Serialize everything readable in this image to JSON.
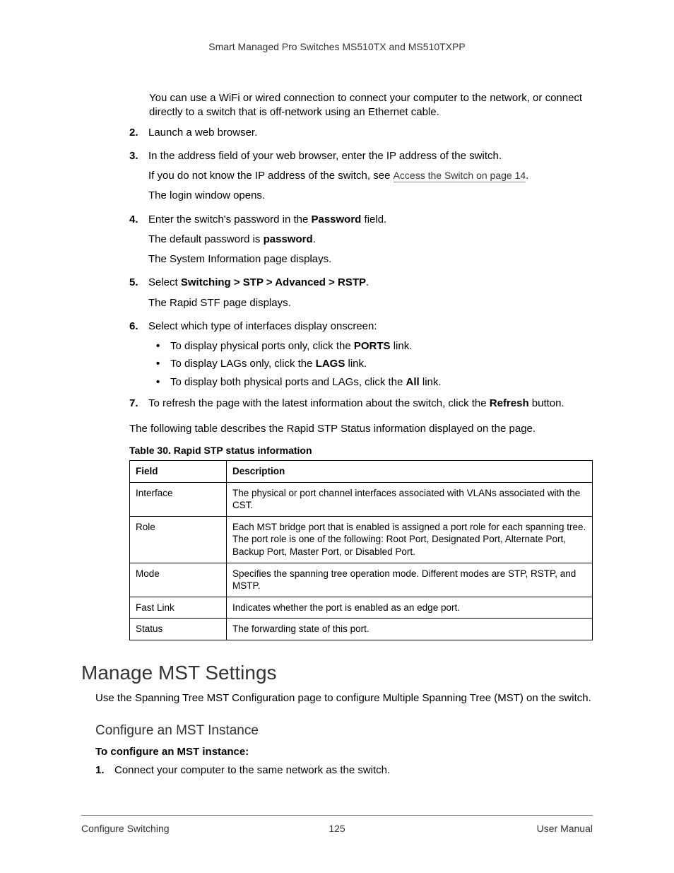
{
  "header": "Smart Managed Pro Switches MS510TX and MS510TXPP",
  "intro_indent": "You can use a WiFi or wired connection to connect your computer to the network, or connect directly to a switch that is off-network using an Ethernet cable.",
  "steps": {
    "s2": {
      "num": "2.",
      "text": "Launch a web browser."
    },
    "s3": {
      "num": "3.",
      "text": "In the address field of your web browser, enter the IP address of the switch.",
      "p1a": "If you do not know the IP address of the switch, see ",
      "link": "Access the Switch on page 14",
      "p1b": ".",
      "p2": "The login window opens."
    },
    "s4": {
      "num": "4.",
      "tpre": "Enter the switch's password in the ",
      "bold": "Password",
      "tpost": " field.",
      "p1a": "The default password is ",
      "p1b": "password",
      "p1c": ".",
      "p2": "The System Information page displays."
    },
    "s5": {
      "num": "5.",
      "tpre": "Select ",
      "bold": "Switching > STP > Advanced > RSTP",
      "tpost": ".",
      "p1": "The Rapid STF page displays."
    },
    "s6": {
      "num": "6.",
      "text": "Select which type of interfaces display onscreen:",
      "bullets": [
        {
          "pre": "To display physical ports only, click the ",
          "bold": "PORTS",
          "post": " link."
        },
        {
          "pre": "To display LAGs only, click the ",
          "bold": "LAGS",
          "post": " link."
        },
        {
          "pre": "To display both physical ports and LAGs, click the ",
          "bold": "All",
          "post": " link."
        }
      ]
    },
    "s7": {
      "num": "7.",
      "pre": "To refresh the page with the latest information about the switch, click the ",
      "bold": "Refresh",
      "post": " button."
    }
  },
  "table_lead": "The following table describes the Rapid STP Status information displayed on the page.",
  "table_caption": "Table 30.  Rapid STP status information",
  "table": {
    "head": {
      "c1": "Field",
      "c2": "Description"
    },
    "rows": [
      {
        "c1": "Interface",
        "c2": "The physical or port channel interfaces associated with VLANs associated with the CST."
      },
      {
        "c1": "Role",
        "c2": "Each MST bridge port that is enabled is assigned a port role for each spanning tree. The port role is one of the following: Root Port, Designated Port, Alternate Port, Backup Port, Master Port, or Disabled Port."
      },
      {
        "c1": "Mode",
        "c2": "Specifies the spanning tree operation mode. Different modes are STP, RSTP, and MSTP."
      },
      {
        "c1": "Fast Link",
        "c2": "Indicates whether the port is enabled as an edge port."
      },
      {
        "c1": "Status",
        "c2": "The forwarding state of this port."
      }
    ]
  },
  "section_title": "Manage MST Settings",
  "section_intro": "Use the Spanning Tree MST Configuration page to configure Multiple Spanning Tree (MST) on the switch.",
  "subsection_title": "Configure an MST Instance",
  "task_lead": "To configure an MST instance:",
  "task_steps": {
    "s1": {
      "num": "1.",
      "text": "Connect your computer to the same network as the switch."
    }
  },
  "footer": {
    "left": "Configure Switching",
    "center": "125",
    "right": "User Manual"
  }
}
